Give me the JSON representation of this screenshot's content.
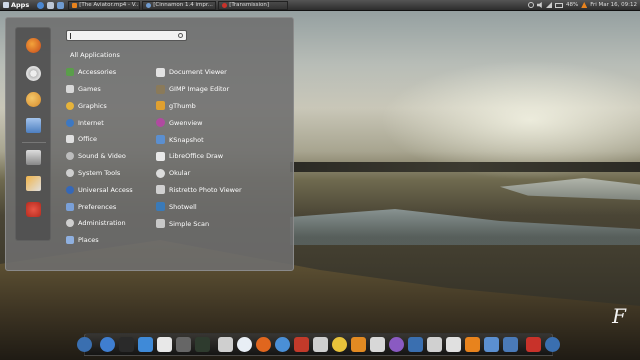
{
  "top_panel": {
    "apps_label": "Apps",
    "quick_launch": [
      "globe-icon",
      "files-icon",
      "folder-icon"
    ],
    "tasks": [
      {
        "label": "[The Aviator.mp4 - V...",
        "icon": "vlc-icon",
        "color": "#e8831d"
      },
      {
        "label": "[Cinnamon 1.4 impr...",
        "icon": "browser-icon",
        "color": "#6f9bd0"
      },
      {
        "label": "[Transmission]",
        "icon": "transmission-icon",
        "color": "#c8322a"
      }
    ],
    "tray": {
      "battery": "48%",
      "clock": "Fri Mar 16, 09:12"
    }
  },
  "menu": {
    "favorites": [
      "firefox-icon",
      "settings-icon",
      "chat-icon",
      "file-manager-icon",
      "terminal-icon",
      "logout-icon",
      "power-icon"
    ],
    "search_placeholder": "",
    "categories": [
      {
        "label": "All Applications",
        "icon": ""
      },
      {
        "label": "Accessories",
        "icon": "accessories-icon",
        "color": "#5a9e4a"
      },
      {
        "label": "Games",
        "icon": "games-icon",
        "color": "#d8d8d8"
      },
      {
        "label": "Graphics",
        "icon": "graphics-icon",
        "color": "#e6b33a"
      },
      {
        "label": "Internet",
        "icon": "internet-icon",
        "color": "#3d78c2"
      },
      {
        "label": "Office",
        "icon": "office-icon",
        "color": "#e0e0e0"
      },
      {
        "label": "Sound & Video",
        "icon": "sound-video-icon",
        "color": "#bcbcbc"
      },
      {
        "label": "System Tools",
        "icon": "system-tools-icon",
        "color": "#cfcfcf"
      },
      {
        "label": "Universal Access",
        "icon": "universal-access-icon",
        "color": "#3568b8"
      },
      {
        "label": "Preferences",
        "icon": "preferences-icon",
        "color": "#7aa0d8"
      },
      {
        "label": "Administration",
        "icon": "administration-icon",
        "color": "#cfcfcf"
      },
      {
        "label": "Places",
        "icon": "places-icon",
        "color": "#8fb0e0"
      }
    ],
    "apps": [
      {
        "label": "Document Viewer",
        "icon": "document-viewer-icon",
        "color": "#e2e2e2"
      },
      {
        "label": "GIMP Image Editor",
        "icon": "gimp-icon",
        "color": "#8a7a5a"
      },
      {
        "label": "gThumb",
        "icon": "gthumb-icon",
        "color": "#e0a030"
      },
      {
        "label": "Gwenview",
        "icon": "gwenview-icon",
        "color": "#b04aa0"
      },
      {
        "label": "KSnapshot",
        "icon": "ksnapshot-icon",
        "color": "#5b8fd0"
      },
      {
        "label": "LibreOffice Draw",
        "icon": "libreoffice-draw-icon",
        "color": "#e8e8e8"
      },
      {
        "label": "Okular",
        "icon": "okular-icon",
        "color": "#dcdcdc"
      },
      {
        "label": "Ristretto Photo Viewer",
        "icon": "ristretto-icon",
        "color": "#d0d0d0"
      },
      {
        "label": "Shotwell",
        "icon": "shotwell-icon",
        "color": "#3a7ab8"
      },
      {
        "label": "Simple Scan",
        "icon": "simple-scan-icon",
        "color": "#c8c8c8"
      }
    ]
  },
  "dock": {
    "items": [
      {
        "icon": "home-launcher-icon",
        "color": "#3a6fb0"
      },
      {
        "icon": "help-icon",
        "color": "#3f7ed0"
      },
      {
        "icon": "terminal-icon",
        "color": "#2a2a2a"
      },
      {
        "icon": "download-icon",
        "color": "#3f8ad8"
      },
      {
        "icon": "text-editor-icon",
        "color": "#e8e8e8"
      },
      {
        "icon": "calculator-icon",
        "color": "#666666"
      },
      {
        "icon": "system-monitor-icon",
        "color": "#2e3b2e"
      },
      {
        "icon": "pen-icon",
        "color": "#cfcfcf"
      },
      {
        "icon": "cloud-icon",
        "color": "#e8eef5"
      },
      {
        "icon": "firefox-icon",
        "color": "#e0661e"
      },
      {
        "icon": "chromium-icon",
        "color": "#4a8fd6"
      },
      {
        "icon": "package-installer-icon",
        "color": "#c23a2a"
      },
      {
        "icon": "media-player-icon",
        "color": "#cfcfcf"
      },
      {
        "icon": "chrome-icon",
        "color": "#e8c23a"
      },
      {
        "icon": "headphones-icon",
        "color": "#e28a22"
      },
      {
        "icon": "network-icon",
        "color": "#d8d8d8"
      },
      {
        "icon": "chat-icon",
        "color": "#8a5ac2"
      },
      {
        "icon": "display-icon",
        "color": "#3a6fb0"
      },
      {
        "icon": "disks-icon",
        "color": "#d0d0d0"
      },
      {
        "icon": "camera-icon",
        "color": "#e0e0e0"
      },
      {
        "icon": "vlc-icon",
        "color": "#e8831d"
      },
      {
        "icon": "folder-icon",
        "color": "#5b8fd0"
      },
      {
        "icon": "screenshot-icon",
        "color": "#4a7ab8"
      },
      {
        "icon": "power-icon",
        "color": "#c8322a"
      },
      {
        "icon": "accessibility-icon",
        "color": "#3a6fb0"
      }
    ]
  },
  "watermark": "F"
}
